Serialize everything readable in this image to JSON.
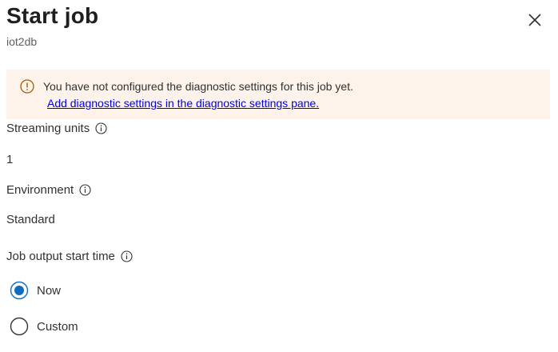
{
  "panel": {
    "title": "Start job",
    "subtitle": "iot2db"
  },
  "banner": {
    "message": "You have not configured the diagnostic settings for this job yet.",
    "link": "Add diagnostic settings in the diagnostic settings pane."
  },
  "fields": {
    "streaming_units_label": "Streaming units",
    "streaming_units_value": "1",
    "environment_label": "Environment",
    "environment_value": "Standard",
    "job_output_start_time_label": "Job output start time"
  },
  "start_time_options": [
    {
      "label": "Now",
      "selected": true
    },
    {
      "label": "Custom",
      "selected": false
    }
  ],
  "colors": {
    "accent": "#0f6cbd",
    "banner_bg": "#fdf3ea",
    "warning_icon": "#a35d00",
    "link": "#0000ee"
  }
}
